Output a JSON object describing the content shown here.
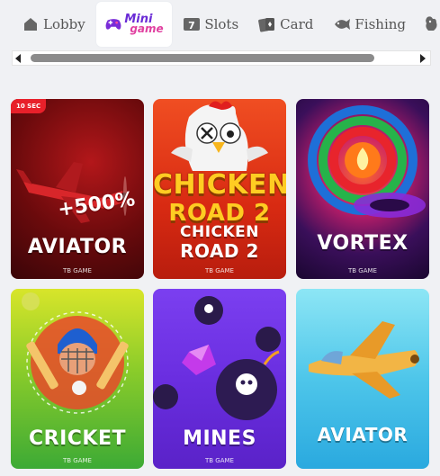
{
  "tabs": [
    {
      "label": "Lobby",
      "icon": "home-icon"
    },
    {
      "label": "Mini game",
      "icon": "gamepad-icon",
      "active": true
    },
    {
      "label": "Slots",
      "icon": "slots-icon"
    },
    {
      "label": "Card",
      "icon": "card-icon"
    },
    {
      "label": "Fishing",
      "icon": "fishing-icon"
    },
    {
      "label": "",
      "icon": "cockfight-icon"
    }
  ],
  "mini_logo": {
    "line1": "Mini",
    "line2": "game"
  },
  "games": [
    {
      "name": "AVIATOR",
      "provider": "TB GAME",
      "badge": "10 SEC",
      "promo": "+500%"
    },
    {
      "name": "CHICKEN ROAD 2",
      "provider": "TB GAME",
      "art_line1": "CHICKEN",
      "art_line2": "ROAD 2",
      "name_line1": "CHICKEN",
      "name_line2": "ROAD 2"
    },
    {
      "name": "VORTEX",
      "provider": "TB GAME"
    },
    {
      "name": "CRICKET",
      "provider": "TB GAME"
    },
    {
      "name": "MINES",
      "provider": "TB GAME"
    },
    {
      "name": "AVIATOR",
      "provider": ""
    }
  ],
  "colors": {
    "active_tab_bg": "#ffffff",
    "page_bg": "#f0f1f4",
    "badge_red": "#e8202a"
  }
}
